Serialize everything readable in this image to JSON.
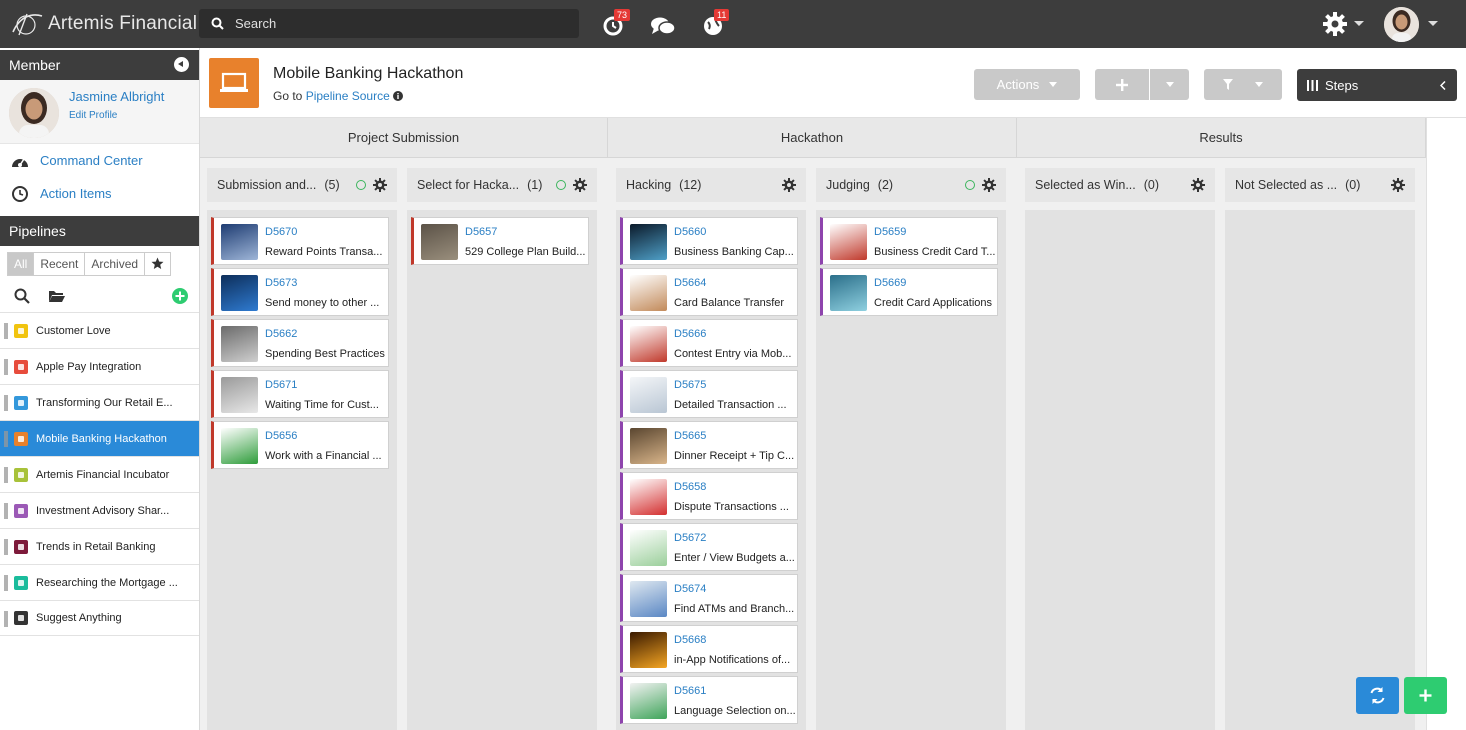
{
  "app": {
    "name": "Artemis Financial"
  },
  "topbar": {
    "search_placeholder": "Search",
    "notifications_badge": "73",
    "alerts_badge": "11"
  },
  "sidebar": {
    "member_heading": "Member",
    "profile": {
      "name": "Jasmine Albright",
      "edit_label": "Edit Profile"
    },
    "links": [
      {
        "label": "Command Center",
        "icon": "dashboard-icon"
      },
      {
        "label": "Action Items",
        "icon": "clock-icon"
      }
    ],
    "pipelines_heading": "Pipelines",
    "filters": {
      "all": "All",
      "recent": "Recent",
      "archived": "Archived"
    },
    "pipelines": [
      {
        "label": "Customer Love",
        "color": "#f1c40f"
      },
      {
        "label": "Apple Pay Integration",
        "color": "#e74c3c"
      },
      {
        "label": "Transforming Our Retail E...",
        "color": "#3498db"
      },
      {
        "label": "Mobile Banking Hackathon",
        "color": "#e8812c"
      },
      {
        "label": "Artemis Financial Incubator",
        "color": "#a8c23a"
      },
      {
        "label": "Investment Advisory Shar...",
        "color": "#9b59b6"
      },
      {
        "label": "Trends in Retail Banking",
        "color": "#7d1a3a"
      },
      {
        "label": "Researching the Mortgage ...",
        "color": "#1abc9c"
      },
      {
        "label": "Suggest Anything",
        "color": "#333333"
      }
    ],
    "active_index": 3
  },
  "header": {
    "title": "Mobile Banking Hackathon",
    "goto_prefix": "Go to",
    "goto_link": "Pipeline Source",
    "actions_label": "Actions",
    "steps_label": "Steps"
  },
  "stages": [
    "Project Submission",
    "Hackathon",
    "Results"
  ],
  "columns": [
    {
      "title": "Submission and...",
      "count": "(5)",
      "check": true
    },
    {
      "title": "Select for Hacka...",
      "count": "(1)",
      "check": true
    },
    {
      "title": "Hacking",
      "count": "(12)",
      "check": false
    },
    {
      "title": "Judging",
      "count": "(2)",
      "check": true
    },
    {
      "title": "Selected as Win...",
      "count": "(0)",
      "check": false
    },
    {
      "title": "Not Selected as ...",
      "count": "(0)",
      "check": false
    }
  ],
  "cards": {
    "col0": [
      {
        "id": "D5670",
        "title": "Reward Points Transa..."
      },
      {
        "id": "D5673",
        "title": "Send money to other ..."
      },
      {
        "id": "D5662",
        "title": "Spending Best Practices"
      },
      {
        "id": "D5671",
        "title": "Waiting Time for Cust..."
      },
      {
        "id": "D5656",
        "title": "Work with a Financial ..."
      }
    ],
    "col1": [
      {
        "id": "D5657",
        "title": "529 College Plan Build..."
      }
    ],
    "col2": [
      {
        "id": "D5660",
        "title": "Business Banking Cap..."
      },
      {
        "id": "D5664",
        "title": "Card Balance Transfer"
      },
      {
        "id": "D5666",
        "title": "Contest Entry via Mob..."
      },
      {
        "id": "D5675",
        "title": "Detailed Transaction ..."
      },
      {
        "id": "D5665",
        "title": "Dinner Receipt + Tip C..."
      },
      {
        "id": "D5658",
        "title": "Dispute Transactions ..."
      },
      {
        "id": "D5672",
        "title": "Enter / View Budgets a..."
      },
      {
        "id": "D5674",
        "title": "Find ATMs and Branch..."
      },
      {
        "id": "D5668",
        "title": "in-App Notifications of..."
      },
      {
        "id": "D5661",
        "title": "Language Selection on..."
      }
    ],
    "col3": [
      {
        "id": "D5659",
        "title": "Business Credit Card T..."
      },
      {
        "id": "D5669",
        "title": "Credit Card Applications"
      }
    ]
  }
}
